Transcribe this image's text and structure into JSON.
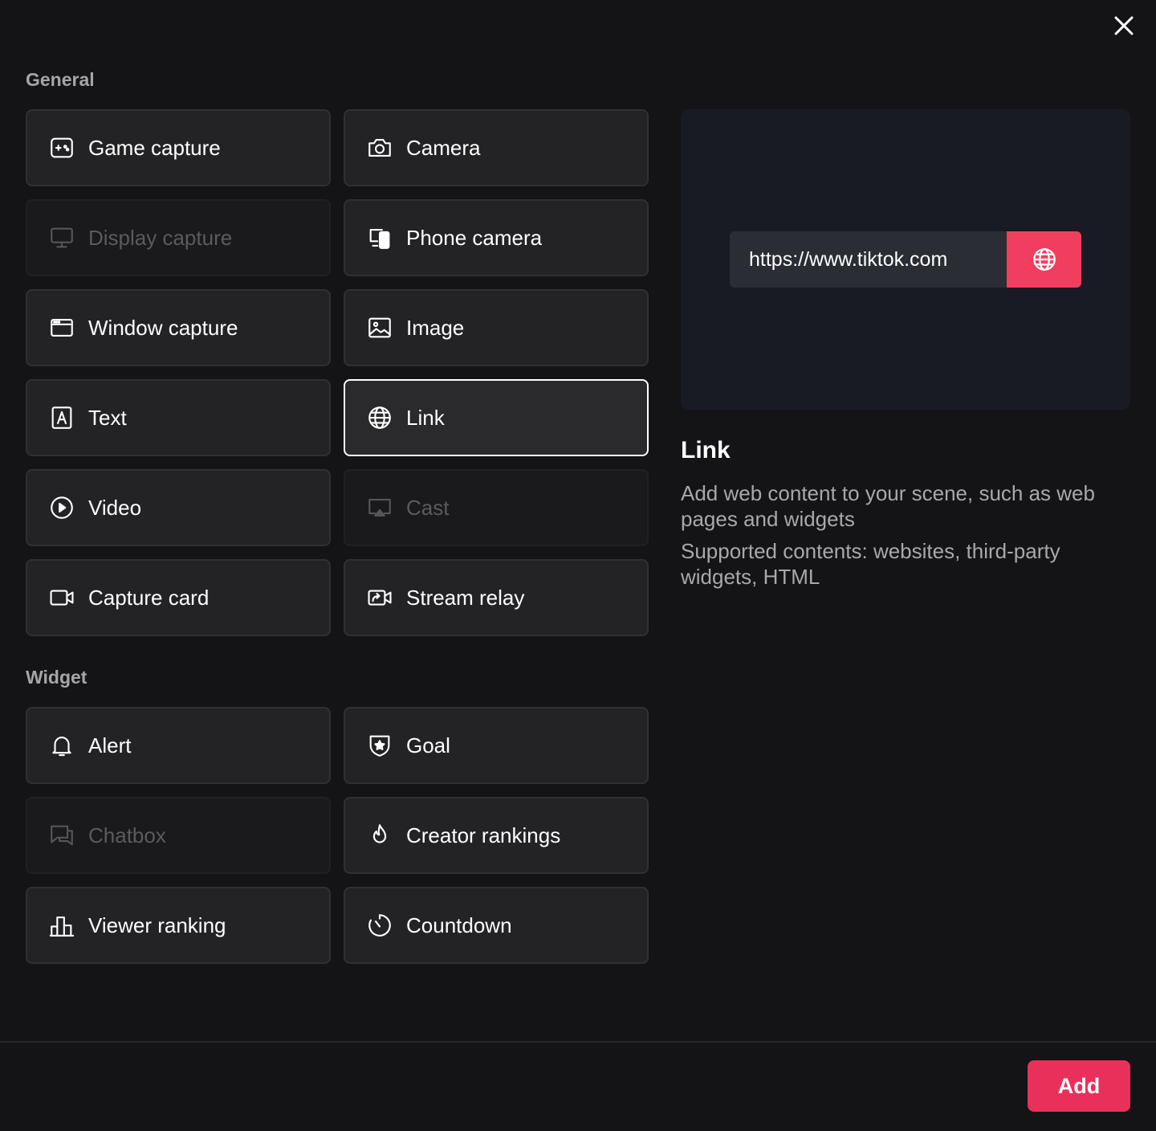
{
  "close_icon": "close-icon",
  "sections": {
    "general": {
      "title": "General",
      "items": [
        {
          "label": "Game capture",
          "icon": "gamepad-icon",
          "state": "enabled"
        },
        {
          "label": "Camera",
          "icon": "camera-icon",
          "state": "enabled"
        },
        {
          "label": "Display capture",
          "icon": "monitor-icon",
          "state": "disabled"
        },
        {
          "label": "Phone camera",
          "icon": "phone-camera-icon",
          "state": "enabled"
        },
        {
          "label": "Window capture",
          "icon": "window-icon",
          "state": "enabled"
        },
        {
          "label": "Image",
          "icon": "image-icon",
          "state": "enabled"
        },
        {
          "label": "Text",
          "icon": "text-icon",
          "state": "enabled"
        },
        {
          "label": "Link",
          "icon": "globe-icon",
          "state": "selected"
        },
        {
          "label": "Video",
          "icon": "play-icon",
          "state": "enabled"
        },
        {
          "label": "Cast",
          "icon": "cast-icon",
          "state": "disabled"
        },
        {
          "label": "Capture card",
          "icon": "video-camera-icon",
          "state": "enabled"
        },
        {
          "label": "Stream relay",
          "icon": "stream-relay-icon",
          "state": "enabled"
        }
      ]
    },
    "widget": {
      "title": "Widget",
      "items": [
        {
          "label": "Alert",
          "icon": "bell-icon",
          "state": "enabled"
        },
        {
          "label": "Goal",
          "icon": "shield-star-icon",
          "state": "enabled"
        },
        {
          "label": "Chatbox",
          "icon": "chat-icon",
          "state": "disabled"
        },
        {
          "label": "Creator rankings",
          "icon": "flame-icon",
          "state": "enabled"
        },
        {
          "label": "Viewer ranking",
          "icon": "podium-icon",
          "state": "enabled"
        },
        {
          "label": "Countdown",
          "icon": "timer-icon",
          "state": "enabled"
        }
      ]
    }
  },
  "preview": {
    "url": "https://www.tiktok.com",
    "button_icon": "globe-icon"
  },
  "detail": {
    "title": "Link",
    "description": "Add web content to your scene, such as web pages and widgets",
    "supported": "Supported contents: websites, third-party widgets, HTML"
  },
  "footer": {
    "add_label": "Add"
  },
  "colors": {
    "background": "#141416",
    "tile": "#232326",
    "accent": "#e8305a",
    "preview_bg": "#181a24"
  }
}
